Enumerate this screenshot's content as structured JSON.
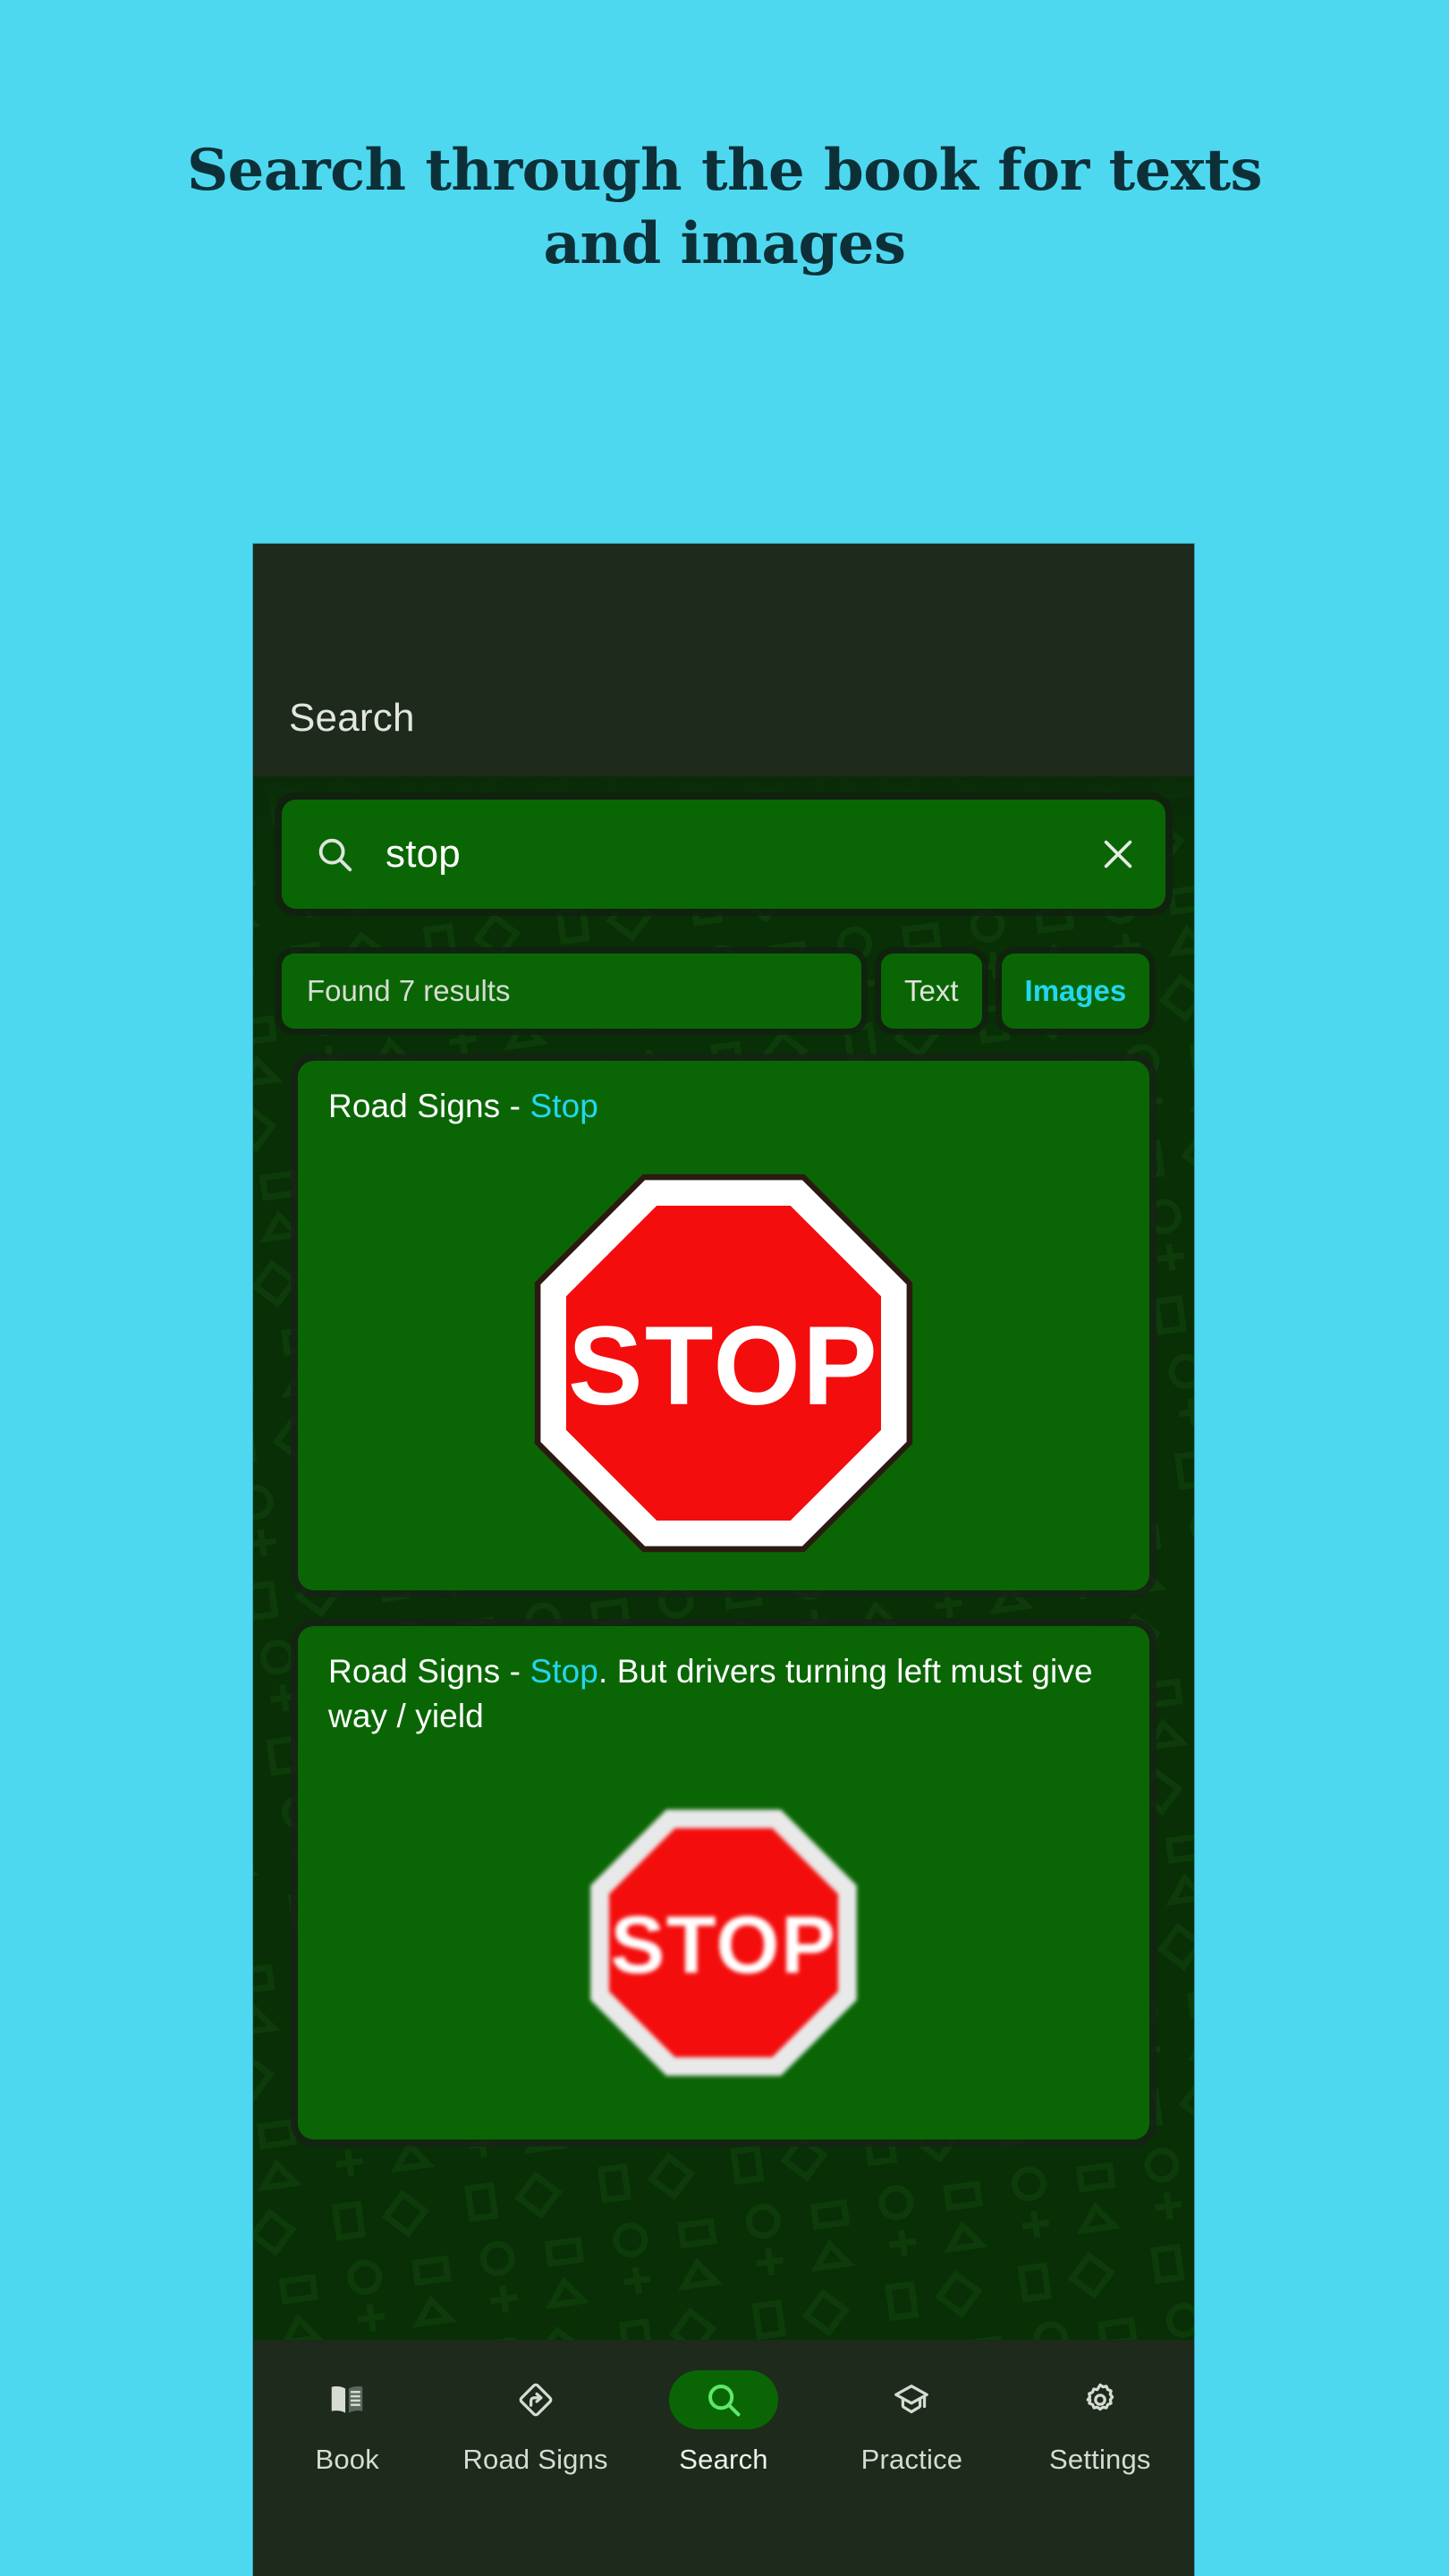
{
  "promo": {
    "headline": "Search through the book for texts and images",
    "background_color": "#4ed8f0",
    "text_color": "#0d3038"
  },
  "app": {
    "appbar": {
      "title": "Search"
    },
    "search": {
      "value": "stop",
      "placeholder": "Search",
      "search_icon": "search-icon",
      "clear_icon": "close-icon"
    },
    "filters": {
      "result_count_label": "Found 7 results",
      "segments": [
        {
          "label": "Text",
          "selected": false
        },
        {
          "label": "Images",
          "selected": true
        }
      ]
    },
    "results": [
      {
        "title_prefix": "Road Signs - ",
        "title_highlight": "Stop",
        "title_suffix": "",
        "image": "stop-sign",
        "blurry": false
      },
      {
        "title_prefix": "Road Signs - ",
        "title_highlight": "Stop",
        "title_suffix": ". But drivers turning left must give way / yield",
        "image": "stop-sign",
        "blurry": true
      }
    ],
    "bottom_nav": [
      {
        "label": "Book",
        "icon": "book-icon",
        "active": false
      },
      {
        "label": "Road Signs",
        "icon": "road-sign-icon",
        "active": false
      },
      {
        "label": "Search",
        "icon": "search-icon",
        "active": true
      },
      {
        "label": "Practice",
        "icon": "graduation-cap-icon",
        "active": false
      },
      {
        "label": "Settings",
        "icon": "gear-icon",
        "active": false
      }
    ],
    "colors": {
      "accent_cyan": "#23d6ef",
      "card_green": "#0a6605",
      "bar_dark": "#1d2a1c",
      "body_green": "#083c06",
      "stop_red": "#f40d0d"
    }
  }
}
